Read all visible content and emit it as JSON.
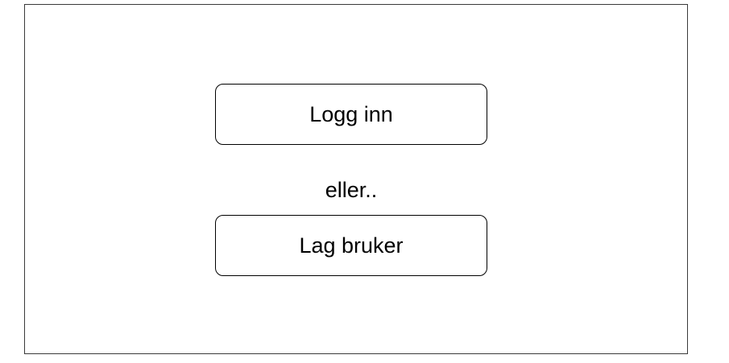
{
  "login": {
    "button_label": "Logg inn"
  },
  "separator": {
    "text": "eller.."
  },
  "signup": {
    "button_label": "Lag bruker"
  }
}
